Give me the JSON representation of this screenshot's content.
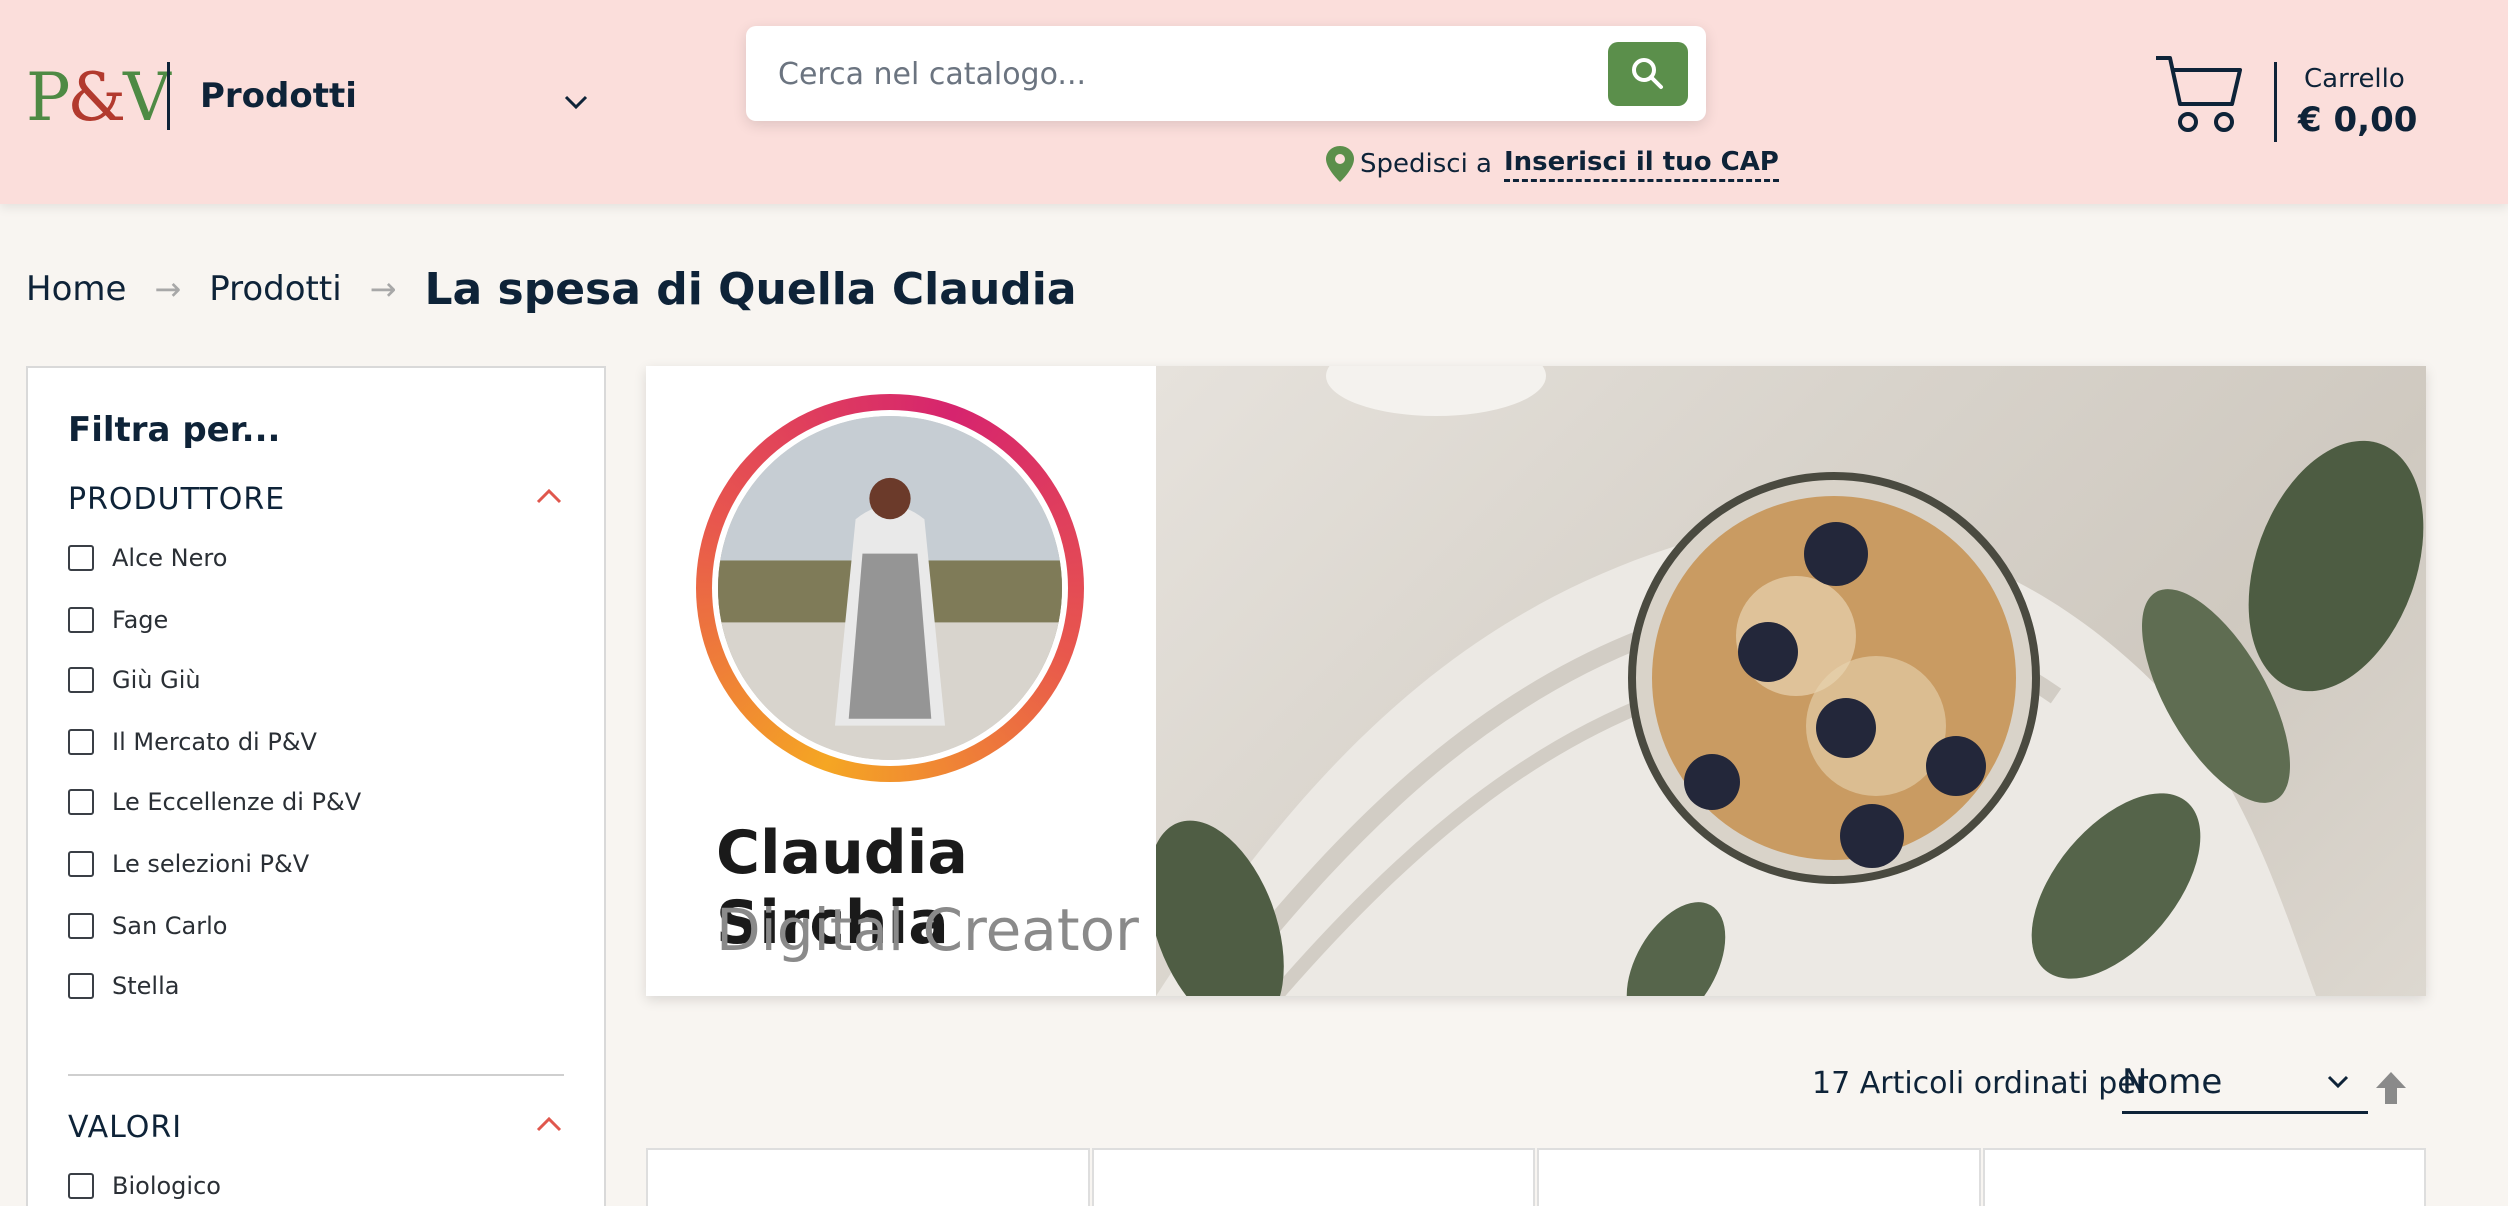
{
  "header": {
    "logo": {
      "p": "P",
      "amp": "&",
      "v": "V"
    },
    "category_label": "Prodotti",
    "search": {
      "placeholder": "Cerca nel catalogo..."
    },
    "shipping": {
      "prefix": "Spedisci a",
      "link": "Inserisci il tuo CAP"
    },
    "cart": {
      "label": "Carrello",
      "total": "€ 0,00"
    }
  },
  "breadcrumb": {
    "items": [
      "Home",
      "Prodotti"
    ],
    "current": "La spesa di Quella Claudia",
    "separator": "→"
  },
  "sidebar": {
    "title": "Filtra per...",
    "sections": [
      {
        "title": "PRODUTTORE",
        "items": [
          "Alce Nero",
          "Fage",
          "Giù Giù",
          "Il Mercato di P&V",
          "Le Eccellenze di P&V",
          "Le selezioni P&V",
          "San Carlo",
          "Stella"
        ]
      },
      {
        "title": "VALORI",
        "items": [
          "Biologico"
        ]
      }
    ]
  },
  "banner": {
    "name": "Claudia Sirchia",
    "role": "Digital Creator"
  },
  "sort": {
    "count_text": "17 Articoli ordinati per",
    "selected": "Nome"
  },
  "colors": {
    "header_bg": "#fbdedb",
    "page_bg": "#f8f5f1",
    "accent_green": "#5b8f4b",
    "text_dark": "#0e2338",
    "chevron_red": "#e0574d"
  },
  "icons": [
    "chevron-down-icon",
    "search-icon",
    "location-pin-icon",
    "cart-icon",
    "chevron-up-icon",
    "sort-arrow-up-icon",
    "checkbox-icon"
  ]
}
